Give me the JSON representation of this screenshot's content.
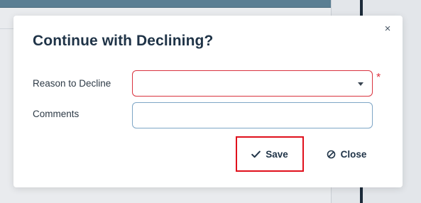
{
  "dialog": {
    "title": "Continue with Declining?",
    "close_icon_glyph": "×"
  },
  "form": {
    "reason": {
      "label": "Reason to Decline",
      "value": "",
      "required_marker": "*"
    },
    "comments": {
      "label": "Comments",
      "value": "",
      "placeholder": ""
    }
  },
  "actions": {
    "save_label": "Save",
    "save_icon": "check-icon",
    "close_label": "Close",
    "close_icon": "ban-icon"
  },
  "colors": {
    "title": "#1f3347",
    "error_border": "#d9333f",
    "required": "#e0313e",
    "focus_border": "#7ea6c6",
    "highlight": "#e0101c"
  }
}
